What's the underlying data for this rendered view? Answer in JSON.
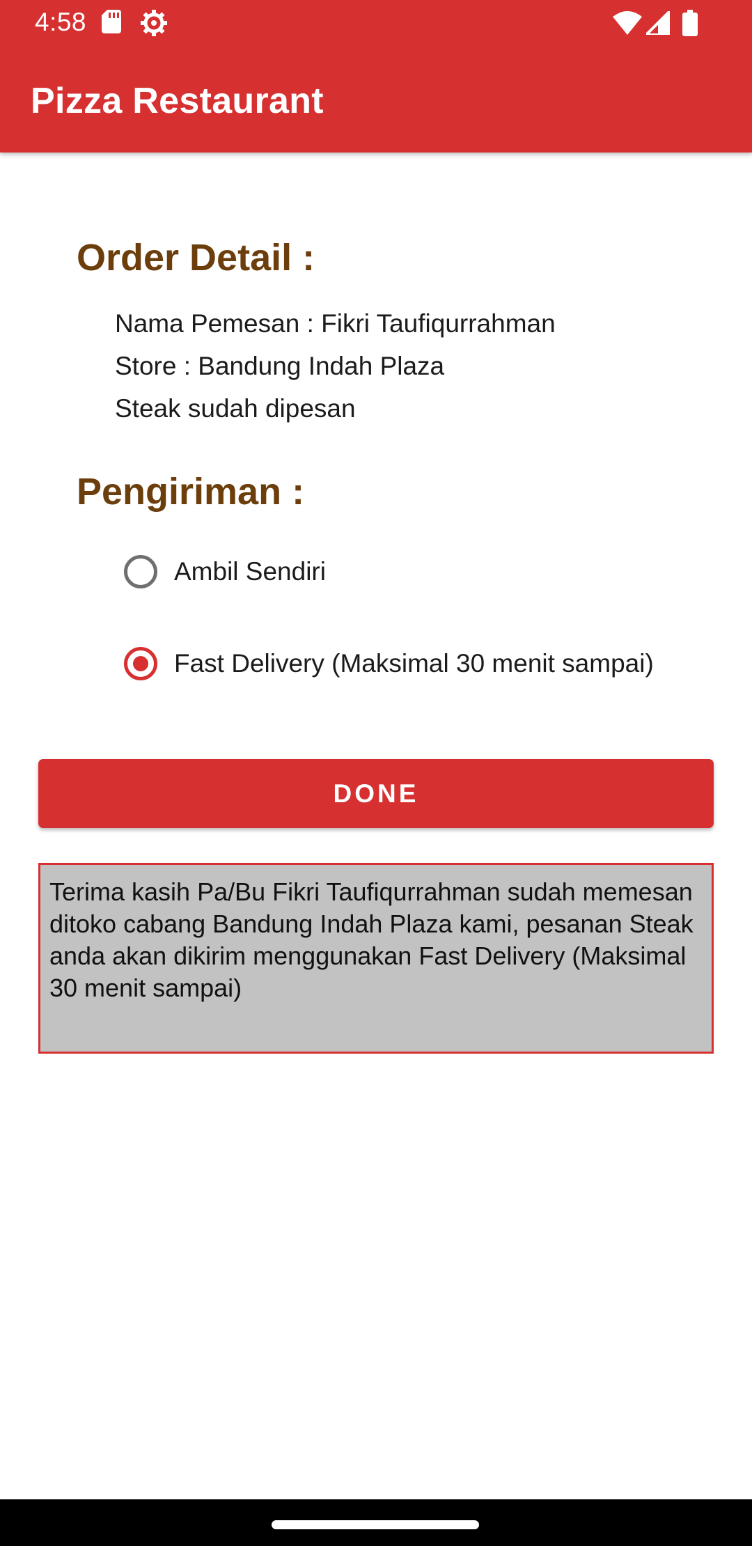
{
  "status_bar": {
    "time": "4:58",
    "icons_left": [
      "sd-card-icon",
      "settings-gear-icon"
    ],
    "icons_right": [
      "wifi-icon",
      "cell-signal-icon",
      "battery-icon"
    ]
  },
  "app_bar": {
    "title": "Pizza Restaurant"
  },
  "order_detail": {
    "heading": "Order Detail :",
    "customer_line": "Nama Pemesan : Fikri Taufiqurrahman",
    "store_line": "Store : Bandung Indah Plaza",
    "item_line": "Steak sudah dipesan"
  },
  "delivery": {
    "heading": "Pengiriman :",
    "options": [
      {
        "label": "Ambil Sendiri",
        "checked": false
      },
      {
        "label": "Fast Delivery (Maksimal 30 menit sampai)",
        "checked": true
      }
    ]
  },
  "done_button": {
    "label": "DONE"
  },
  "result": {
    "message": "Terima kasih Pa/Bu Fikri Taufiqurrahman sudah memesan ditoko cabang Bandung Indah Plaza kami, pesanan Steak anda akan dikirim menggunakan Fast Delivery (Maksimal 30 menit sampai)"
  },
  "colors": {
    "primary": "#d63031",
    "heading": "#6b3e0c",
    "result_background": "#c2c2c2"
  }
}
